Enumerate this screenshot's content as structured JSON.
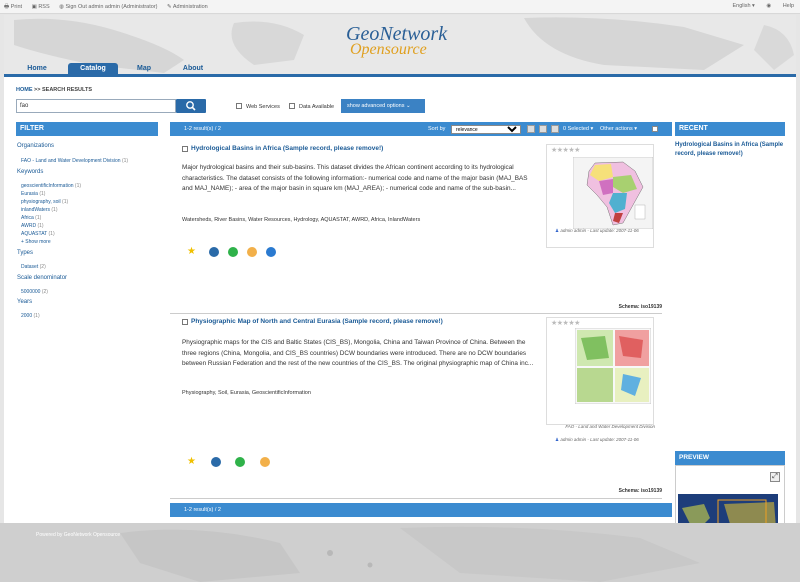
{
  "topbar": {
    "left_items": [
      "Print",
      "RSS",
      "Sign Out admin admin (Administrator)",
      "Administration"
    ],
    "language": "English",
    "help": "Help"
  },
  "logo": {
    "line1": "GeoNetwork",
    "line2": "Opensource"
  },
  "nav": {
    "tabs": [
      "Home",
      "Catalog",
      "Map",
      "About"
    ],
    "active": "Catalog"
  },
  "breadcrumb": {
    "home": "HOME",
    "sep": ">>",
    "current": "SEARCH RESULTS"
  },
  "search": {
    "value": "fao",
    "web_services": "Web Services",
    "data_available": "Data Available",
    "advanced": "show advanced options"
  },
  "filter": {
    "title": "FILTER",
    "sections": [
      {
        "label": "Organizations",
        "items": [
          {
            "label": "FAO - Land and Water Development Division",
            "count": "(1)"
          }
        ]
      },
      {
        "label": "Keywords",
        "items": [
          {
            "label": "geoscientificInformation",
            "count": "(1)"
          },
          {
            "label": "Eurasia",
            "count": "(1)"
          },
          {
            "label": "physiography, soil",
            "count": "(1)"
          },
          {
            "label": "inlandWaters",
            "count": "(1)"
          },
          {
            "label": "Africa",
            "count": "(1)"
          },
          {
            "label": "AWRD",
            "count": "(1)"
          },
          {
            "label": "AQUASTAT",
            "count": "(1)"
          }
        ],
        "more": "+ Show more"
      },
      {
        "label": "Types",
        "items": [
          {
            "label": "Dataset",
            "count": "(2)"
          }
        ]
      },
      {
        "label": "Scale denominator",
        "items": [
          {
            "label": "5000000",
            "count": "(2)"
          }
        ]
      },
      {
        "label": "Years",
        "items": [
          {
            "label": "2000",
            "count": "(1)"
          }
        ]
      }
    ]
  },
  "results": {
    "count": "1-2 result(s) / 2",
    "sort_by": "Sort by",
    "sort_value": "relevance",
    "selected": "0 Selected",
    "other_actions": "Other actions",
    "records": [
      {
        "title": "Hydrological Basins in Africa (Sample record, please remove!)",
        "abstract": "Major hydrological basins and their sub-basins. This dataset divides the African continent according to its hydrological characteristics. The dataset consists of the following information:- numerical code and name of the major basin (MAJ_BAS and MAJ_NAME); - area of the major basin in square km (MAJ_AREA); - numerical code and name of the sub-basin...",
        "keywords": "Watersheds, River Basins, Water Resources, Hydrology, AQUASTAT, AWRD, Africa, InlandWaters",
        "meta": "admin admin - Last update: 2007-11-06",
        "org": "",
        "schema": "Schema: iso19139"
      },
      {
        "title": "Physiographic Map of North and Central Eurasia (Sample record, please remove!)",
        "abstract": "Physiographic maps for the CIS and Baltic States (CIS_BS), Mongolia, China and Taiwan Province of China. Between the three regions (China, Mongolia, and CIS_BS countries) DCW boundaries were introduced. There are no DCW boundaries between Russian Federation and the rest of the new countries of the CIS_BS. The original physiographic map of China inc...",
        "keywords": "Physiography, Soil, Eurasia, GeoscientificInformation",
        "meta": "admin admin - Last update: 2007-11-06",
        "org": "FAO - Land and Water Development Division",
        "schema": "Schema: iso19139"
      }
    ],
    "footer_count": "1-2 result(s) / 2"
  },
  "recent": {
    "title": "RECENT",
    "item": "Hydrological Basins in Africa (Sample record, please remove!)"
  },
  "preview": {
    "title": "PREVIEW"
  },
  "footer": {
    "text": "Powered by GeoNetwork Opensource"
  },
  "colors": {
    "accent": "#3b8bd0",
    "nav": "#2a6aa8",
    "link": "#1a5a96",
    "logo_orange": "#e0a020"
  }
}
